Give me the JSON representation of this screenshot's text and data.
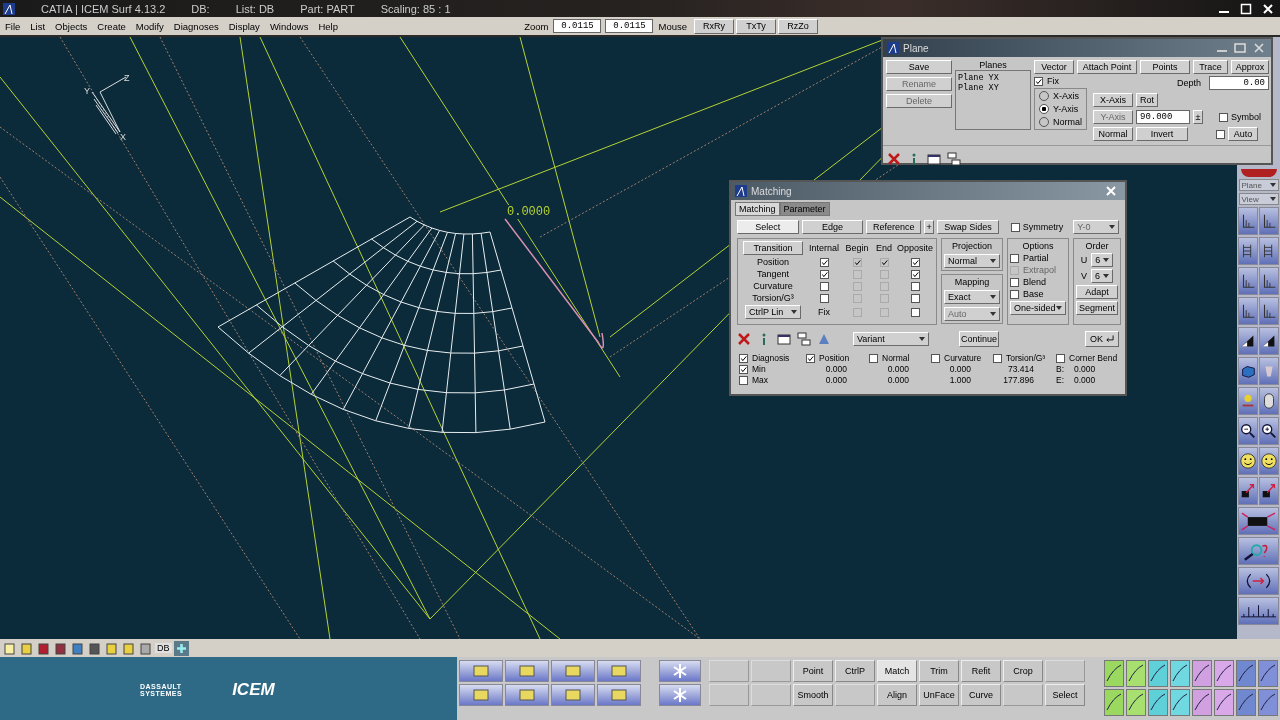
{
  "window": {
    "title": "CATIA | ICEM Surf 4.13.2",
    "db": "DB:",
    "list": "List: DB",
    "part": "Part: PART",
    "scaling": "Scaling: 85 : 1"
  },
  "menu": [
    "File",
    "List",
    "Objects",
    "Create",
    "Modify",
    "Diagnoses",
    "Display",
    "Windows",
    "Help"
  ],
  "zoom": {
    "label": "Zoom",
    "value": "0.0115",
    "value_2": "0.0115"
  },
  "mouse": {
    "label": "Mouse",
    "buttons": [
      "RxRy",
      "TxTy",
      "RzZo"
    ]
  },
  "viewport": {
    "triad_labels": [
      "Y",
      "Z",
      "X"
    ],
    "value_label": "0.0000"
  },
  "plane_dialog": {
    "title": "Plane",
    "side_buttons": [
      {
        "label": "Save",
        "disabled": false
      },
      {
        "label": "Rename",
        "disabled": true
      },
      {
        "label": "Delete",
        "disabled": true
      }
    ],
    "planes_header": "Planes",
    "planes": [
      "Plane YX",
      "Plane XY"
    ],
    "top_buttons": [
      "Vector",
      "Attach Point",
      "Points",
      "Trace",
      "Approx"
    ],
    "fix": {
      "label": "Fix",
      "checked": true
    },
    "radios": [
      {
        "label": "X-Axis",
        "selected": false
      },
      {
        "label": "Y-Axis",
        "selected": true
      },
      {
        "label": "Normal",
        "selected": false
      }
    ],
    "depth": {
      "label": "Depth",
      "value": "0.00"
    },
    "axis_buttons": [
      {
        "label": "X-Axis",
        "disabled": false
      },
      {
        "label": "Y-Axis",
        "disabled": true
      },
      {
        "label": "Normal",
        "disabled": false
      }
    ],
    "rot": "Rot",
    "angle": "90.000",
    "stepper": "±",
    "invert": "Invert",
    "symbol": {
      "label": "Symbol",
      "checked": false
    },
    "auto": {
      "label": "Auto",
      "checked": false
    }
  },
  "matching_dialog": {
    "title": "Matching",
    "tabs": [
      {
        "label": "Matching",
        "selected": true
      },
      {
        "label": "Parameter",
        "selected": false
      }
    ],
    "mode_buttons": [
      {
        "label": "Select",
        "selected": true
      },
      {
        "label": "Edge",
        "selected": false
      },
      {
        "label": "Reference",
        "selected": false
      }
    ],
    "plus": "+",
    "swap": "Swap Sides",
    "symmetry": {
      "label": "Symmetry",
      "checked": false
    },
    "symmetry_axis": "Y-0",
    "transition": {
      "button": "Transition",
      "columns": [
        "Internal",
        "Begin",
        "End",
        "Opposite"
      ],
      "rows": [
        {
          "label": "Position",
          "cells": [
            {
              "checked": true,
              "disabled": false
            },
            {
              "checked": true,
              "disabled": true
            },
            {
              "checked": true,
              "disabled": true
            },
            {
              "checked": true,
              "disabled": false
            }
          ]
        },
        {
          "label": "Tangent",
          "cells": [
            {
              "checked": true,
              "disabled": false
            },
            {
              "checked": false,
              "disabled": true
            },
            {
              "checked": false,
              "disabled": true
            },
            {
              "checked": true,
              "disabled": false
            }
          ]
        },
        {
          "label": "Curvature",
          "cells": [
            {
              "checked": false,
              "disabled": false
            },
            {
              "checked": false,
              "disabled": true
            },
            {
              "checked": false,
              "disabled": true
            },
            {
              "checked": false,
              "disabled": false
            }
          ]
        },
        {
          "label": "Torsion/G³",
          "cells": [
            {
              "checked": false,
              "disabled": false
            },
            {
              "checked": false,
              "disabled": true
            },
            {
              "checked": false,
              "disabled": true
            },
            {
              "checked": false,
              "disabled": false
            }
          ]
        }
      ],
      "footer": {
        "dropdown": "CtrlP Lin",
        "label": "Fix",
        "cells": [
          {
            "checked": false,
            "disabled": true
          },
          {
            "checked": false,
            "disabled": true
          },
          {
            "checked": false,
            "disabled": false
          }
        ]
      }
    },
    "projection": {
      "label": "Projection",
      "value": "Normal"
    },
    "mapping": {
      "label": "Mapping",
      "value": "Exact",
      "value_2": "Auto"
    },
    "options": {
      "label": "Options",
      "checks": [
        {
          "label": "Partial",
          "checked": false,
          "disabled": false
        },
        {
          "label": "Extrapol",
          "checked": false,
          "disabled": true
        },
        {
          "label": "Blend",
          "checked": false,
          "disabled": false
        },
        {
          "label": "Base",
          "checked": false,
          "disabled": false
        }
      ],
      "mode": "One-sided"
    },
    "order": {
      "label": "Order",
      "u_label": "U",
      "u": "6",
      "v_label": "V",
      "v": "6",
      "buttons": [
        "Adapt",
        "Segment"
      ]
    },
    "variant": "Variant",
    "continue": "Continue",
    "ok": "OK",
    "diagnosis": {
      "checks": [
        {
          "label": "Diagnosis",
          "checked": true
        },
        {
          "label": "Position",
          "checked": true
        },
        {
          "label": "Normal",
          "checked": false
        },
        {
          "label": "Curvature",
          "checked": false
        },
        {
          "label": "Torsion/G³",
          "checked": false
        },
        {
          "label": "Corner Bend",
          "checked": false
        }
      ],
      "rows": [
        {
          "label": "Min",
          "checked": true,
          "values": [
            "0.000",
            "0.000",
            "0.000",
            "73.414"
          ],
          "end_label": "B:",
          "end_value": "0.000"
        },
        {
          "label": "Max",
          "checked": false,
          "values": [
            "0.000",
            "0.000",
            "1.000",
            "177.896"
          ],
          "end_label": "E:",
          "end_value": "0.000"
        }
      ]
    }
  },
  "right_toolbar": {
    "dropdowns": [
      "Plane",
      "View"
    ]
  },
  "bottom_toolbar": {
    "db": "DB"
  },
  "brand": {
    "company": [
      "DASSAULT",
      "SYSTEMES"
    ],
    "product": "ICEM"
  },
  "commands": [
    [
      {
        "kind": "blank"
      },
      {
        "kind": "blank"
      },
      {
        "kind": "command",
        "label": "Point",
        "selected": false
      },
      {
        "kind": "command",
        "label": "CtrlP",
        "selected": false
      },
      {
        "kind": "command",
        "label": "Match",
        "selected": true
      },
      {
        "kind": "command",
        "label": "Trim",
        "selected": false
      },
      {
        "kind": "command",
        "label": "Refit",
        "selected": false
      },
      {
        "kind": "command",
        "label": "Crop",
        "selected": false
      },
      {
        "kind": "blank"
      }
    ],
    [
      {
        "kind": "blank"
      },
      {
        "kind": "blank"
      },
      {
        "kind": "command",
        "label": "Smooth",
        "selected": false
      },
      {
        "kind": "blank"
      },
      {
        "kind": "command",
        "label": "Align",
        "selected": false
      },
      {
        "kind": "command",
        "label": "UnFace",
        "selected": false
      },
      {
        "kind": "command",
        "label": "Curve",
        "selected": false
      },
      {
        "kind": "blank"
      },
      {
        "kind": "command",
        "label": "Select",
        "selected": false
      }
    ]
  ]
}
